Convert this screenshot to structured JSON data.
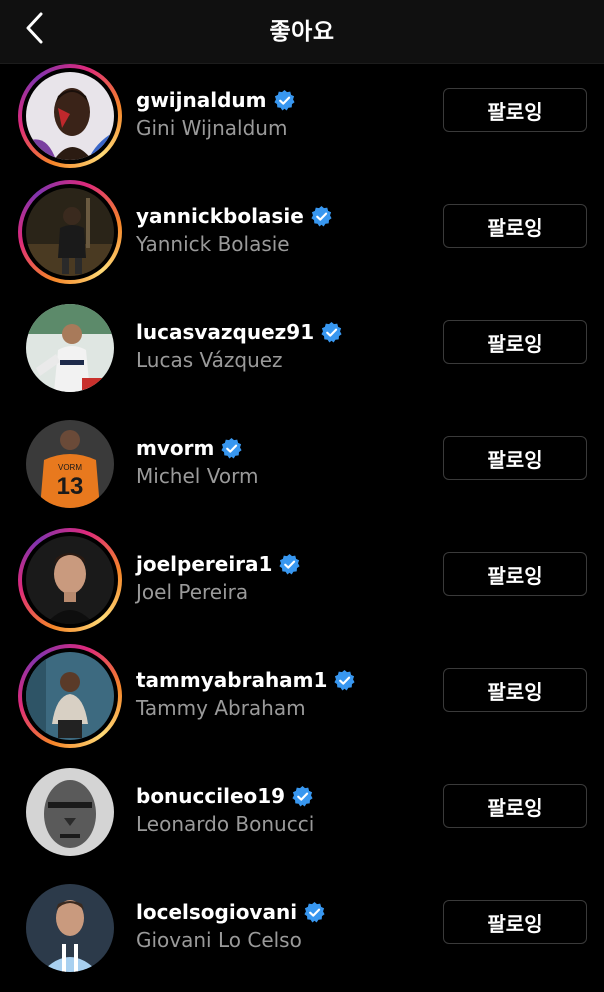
{
  "header": {
    "title": "좋아요",
    "back_icon": "chevron-left-icon"
  },
  "colors": {
    "background": "#000000",
    "header_bg": "#101010",
    "username": "#ffffff",
    "fullname": "#9a9a9a",
    "verified_blue": "#3897f0",
    "button_border": "#3a3a3a"
  },
  "users": [
    {
      "username": "gwijnaldum",
      "full_name": "Gini Wijnaldum",
      "button_label": "팔로잉",
      "verified": true,
      "has_story": true
    },
    {
      "username": "yannickbolasie",
      "full_name": "Yannick Bolasie",
      "button_label": "팔로잉",
      "verified": true,
      "has_story": true
    },
    {
      "username": "lucasvazquez91",
      "full_name": "Lucas Vázquez",
      "button_label": "팔로잉",
      "verified": true,
      "has_story": false
    },
    {
      "username": "mvorm",
      "full_name": "Michel Vorm",
      "button_label": "팔로잉",
      "verified": true,
      "has_story": false
    },
    {
      "username": "joelpereira1",
      "full_name": "Joel Pereira",
      "button_label": "팔로잉",
      "verified": true,
      "has_story": true
    },
    {
      "username": "tammyabraham1",
      "full_name": "Tammy Abraham",
      "button_label": "팔로잉",
      "verified": true,
      "has_story": true
    },
    {
      "username": "bonuccileo19",
      "full_name": "Leonardo Bonucci",
      "button_label": "팔로잉",
      "verified": true,
      "has_story": false
    },
    {
      "username": "locelsogiovani",
      "full_name": "Giovani Lo Celso",
      "button_label": "팔로잉",
      "verified": true,
      "has_story": false
    }
  ]
}
